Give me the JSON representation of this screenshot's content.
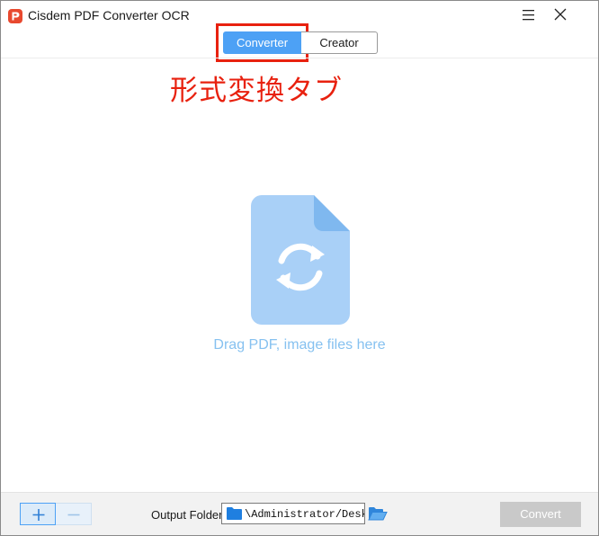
{
  "window": {
    "title": "Cisdem PDF Converter OCR",
    "app_icon": "cisdem-logo-icon"
  },
  "title_controls": {
    "menu_icon": "hamburger-menu-icon",
    "close_icon": "close-icon"
  },
  "tabs": [
    {
      "label": "Converter",
      "selected": true
    },
    {
      "label": "Creator",
      "selected": false
    }
  ],
  "annotation": {
    "text": "形式変換タブ",
    "color": "#e8210f"
  },
  "drop_zone": {
    "icon": "file-convert-icon",
    "text": "Drag PDF, image files here",
    "color": "#86c1f0"
  },
  "bottom_bar": {
    "add_icon": "plus-icon",
    "remove_icon": "minus-icon",
    "output_folder_label": "Output Folder",
    "output_path": "\\Administrator/Desktop",
    "browse_icon": "open-folder-icon",
    "convert_label": "Convert"
  },
  "colors": {
    "accent": "#4da1f5",
    "highlight_border": "#e8210f",
    "disabled_button": "#c9c9c9"
  }
}
